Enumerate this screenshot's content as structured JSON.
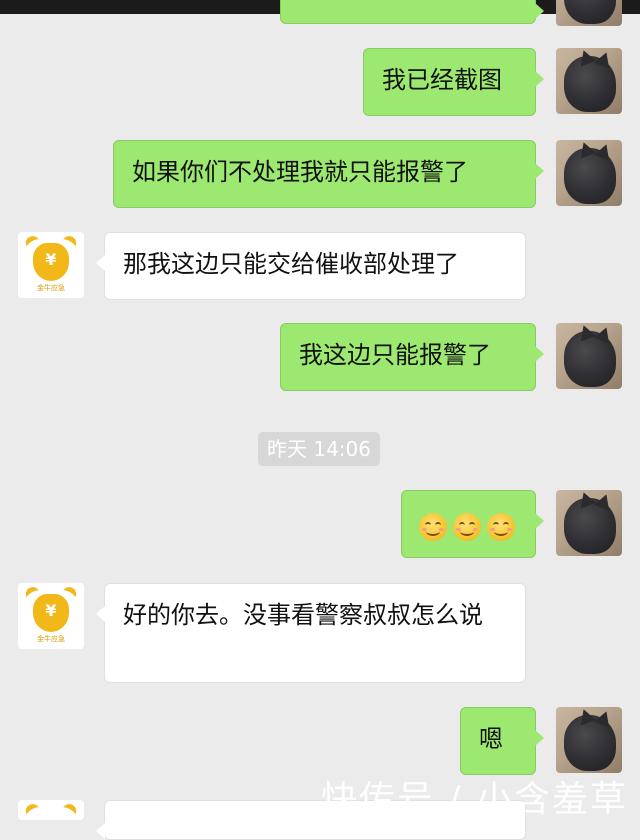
{
  "messages": [
    {
      "from": "me",
      "text": "我已经截图"
    },
    {
      "from": "me",
      "text": "如果你们不处理我就只能报警了"
    },
    {
      "from": "them",
      "text": "那我这边只能交给催收部处理了"
    },
    {
      "from": "me",
      "text": "我这边只能报警了"
    },
    {
      "from": "me",
      "text": ""
    },
    {
      "from": "them",
      "text": "好的你去。没事看警察叔叔怎么说"
    },
    {
      "from": "me",
      "text": "嗯"
    }
  ],
  "timestamp": "昨天 14:06",
  "emoji_count": 3,
  "emoji_icon": "smile-emoji",
  "other_avatar": {
    "symbol": "¥",
    "brand": "金牛应急"
  },
  "watermark": "快传号 / 小含羞草",
  "colors": {
    "my_bubble": "#9de870",
    "their_bubble": "#ffffff",
    "background": "#ebebeb"
  }
}
